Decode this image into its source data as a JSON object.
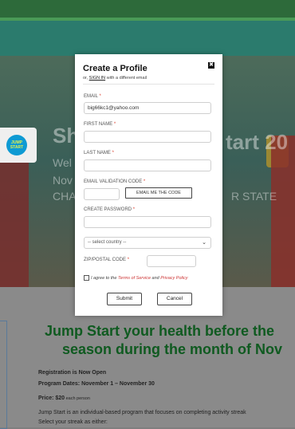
{
  "hero": {
    "title_left": "Sh",
    "title_right": "tart 20",
    "welcome": "Wel",
    "dates": "Nov",
    "challenge": "CHA",
    "state": "R STATE",
    "badge": "JUMP START"
  },
  "content": {
    "heading_line1": "Jump Start your health before the",
    "heading_line2": "season during the month of Nov",
    "registration": "Registration is Now Open",
    "program_dates": "Program Dates: November 1 – November 30",
    "price_label": "Price: $20",
    "price_suffix": " each person",
    "description": "Jump Start is an individual-based program that focuses on completing activity streak",
    "select_streak": "Select your streak as either:"
  },
  "modal": {
    "title": "Create a Profile",
    "subtitle_prefix": "or, ",
    "sign_in_link": "SIGN IN",
    "subtitle_suffix": " with a different email",
    "close_icon": "✖",
    "fields": {
      "email_label": "EMAIL",
      "email_value": "big66kc1@yahoo.com",
      "first_name_label": "FIRST NAME",
      "last_name_label": "LAST NAME",
      "validation_label": "EMAIL VALIDATION CODE",
      "email_code_button": "EMAIL ME THE CODE",
      "password_label": "CREATE PASSWORD",
      "country_placeholder": "-- select country --",
      "zip_label": "ZIP/POSTAL CODE",
      "required_mark": "*"
    },
    "agree": {
      "prefix": "I agree to the ",
      "terms": "Terms of Service",
      "and": " and ",
      "privacy": "Privacy Policy"
    },
    "submit_label": "Submit",
    "cancel_label": "Cancel"
  },
  "colors": {
    "accent_green": "#0f5a20",
    "required_red": "#d43"
  }
}
